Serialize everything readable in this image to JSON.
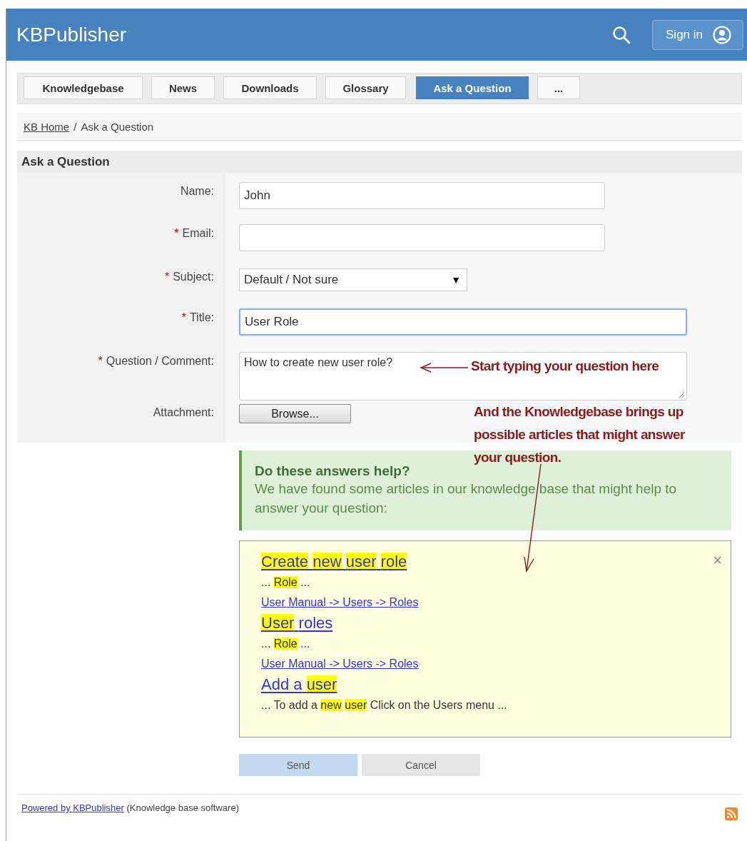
{
  "header": {
    "logo": "KBPublisher",
    "sign_in": "Sign in"
  },
  "nav_tabs": [
    {
      "label": "Knowledgebase",
      "selected": false
    },
    {
      "label": "News",
      "selected": false
    },
    {
      "label": "Downloads",
      "selected": false
    },
    {
      "label": "Glossary",
      "selected": false
    },
    {
      "label": "Ask a Question",
      "selected": true
    },
    {
      "label": "...",
      "selected": false
    }
  ],
  "breadcrumb": {
    "link": "KB Home",
    "separator": "/",
    "current": "Ask a Question"
  },
  "section_title": "Ask a Question",
  "required_mark": "*",
  "form_fields": [
    {
      "kind": "text",
      "label": "Name:",
      "required": false,
      "value": "John",
      "focused": false
    },
    {
      "kind": "text",
      "label": "Email:",
      "required": true,
      "focused": false
    },
    {
      "kind": "select",
      "label": "Subject:",
      "required": true,
      "value": "Default / Not sure",
      "arrow": "▼",
      "focused": false
    },
    {
      "kind": "text",
      "label": "Title:",
      "required": true,
      "value": "User Role",
      "focused": true
    },
    {
      "kind": "textarea",
      "label": "Question / Comment:",
      "required": true,
      "value": "How to create new user role?",
      "focused": false
    },
    {
      "kind": "file",
      "label": "Attachment:",
      "required": false,
      "button": "Browse..."
    }
  ],
  "help_box": {
    "title": "Do these answers help?",
    "text": "We have found some articles in our knowledge base that might help to answer your question:"
  },
  "results": {
    "close": "×",
    "items": [
      {
        "title": [
          {
            "text": "Create",
            "highlighted": true
          },
          {
            "text": "new",
            "highlighted": true
          },
          {
            "text": "user",
            "highlighted": true
          },
          {
            "text": "role",
            "highlighted": true
          }
        ],
        "snippet": [
          {
            "text": "...",
            "highlighted": false
          },
          {
            "text": "Role",
            "highlighted": true
          },
          {
            "text": "...",
            "highlighted": false
          }
        ],
        "path": "User Manual -> Users -> Roles"
      },
      {
        "title": [
          {
            "text": "User",
            "highlighted": true
          },
          {
            "text": "roles",
            "highlighted": false
          }
        ],
        "snippet": [
          {
            "text": "...",
            "highlighted": false
          },
          {
            "text": "Role",
            "highlighted": true
          },
          {
            "text": "...",
            "highlighted": false
          }
        ],
        "path": "User Manual -> Users -> Roles"
      },
      {
        "title": [
          {
            "text": "Add a",
            "highlighted": false
          },
          {
            "text": "user",
            "highlighted": true
          }
        ],
        "snippet": [
          {
            "text": "... To add a",
            "highlighted": false
          },
          {
            "text": "new",
            "highlighted": true
          },
          {
            "text": "user",
            "highlighted": true
          },
          {
            "text": "Click on the Users menu ...",
            "highlighted": false
          }
        ]
      }
    ]
  },
  "buttons": [
    {
      "kind": "primary",
      "label": "Send"
    },
    {
      "kind": "secondary",
      "label": "Cancel"
    }
  ],
  "footer": {
    "link": "Powered by KBPublisher",
    "text": "(Knowledge base software)"
  },
  "annotations": [
    {
      "text": "Start typing your question here"
    },
    {
      "text": "And the Knowledgebase brings up possible articles that might answer your question."
    }
  ]
}
